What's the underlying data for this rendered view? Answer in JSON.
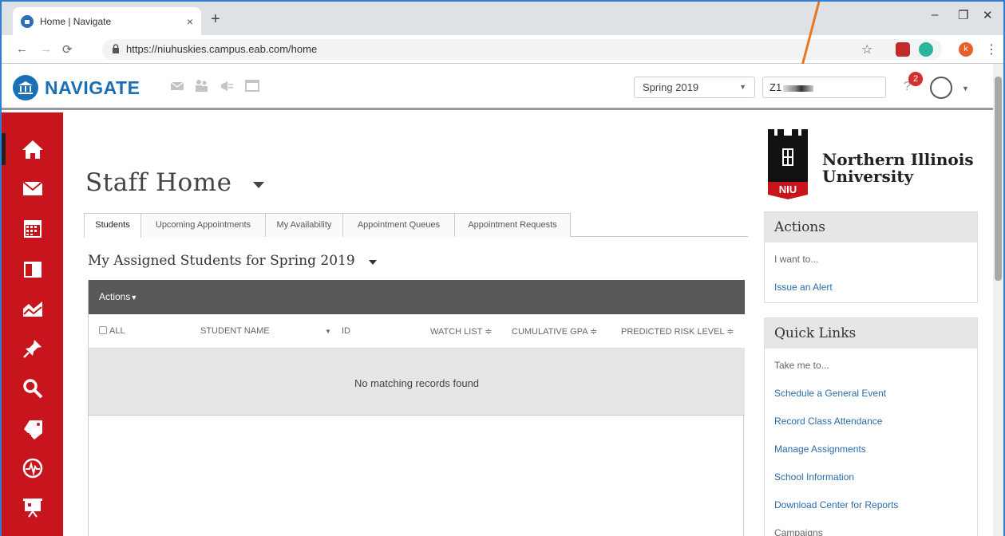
{
  "browser": {
    "tab_title": "Home | Navigate",
    "tab_close": "×",
    "new_tab": "+",
    "url": "https://niuhuskies.campus.eab.com/home",
    "profile_initial": "k",
    "window_controls": {
      "minimize": "–",
      "restore": "❐",
      "close": "✕"
    }
  },
  "header": {
    "brand": "NAVIGATE",
    "term": "Spring 2019",
    "search_value": "Z1",
    "notification_count": "2",
    "help": "?"
  },
  "sidebar": {
    "items": [
      "home-icon",
      "mail-icon",
      "calendar-icon",
      "book-icon",
      "reports-icon",
      "pin-icon",
      "search-icon",
      "add-tag-icon",
      "pulse-icon",
      "presentation-icon"
    ]
  },
  "main": {
    "title": "Staff Home",
    "tabs": [
      "Students",
      "Upcoming Appointments",
      "My Availability",
      "Appointment Queues",
      "Appointment Requests"
    ],
    "subheading": "My Assigned Students for Spring 2019",
    "table": {
      "actions_label": "Actions",
      "columns": {
        "all": "ALL",
        "student_name": "STUDENT NAME",
        "id": "ID",
        "watch_list": "WATCH LIST ≑",
        "gpa": "CUMULATIVE GPA ≑",
        "risk": "PREDICTED RISK LEVEL ≑"
      },
      "empty_message": "No matching records found"
    }
  },
  "right": {
    "university_line1": "Northern Illinois",
    "university_line2": "University",
    "seal_text": "NIU",
    "actions_panel": {
      "title": "Actions",
      "prompt": "I want to...",
      "links": [
        "Issue an Alert"
      ]
    },
    "quick_links_panel": {
      "title": "Quick Links",
      "prompt": "Take me to...",
      "links": [
        "Schedule a General Event",
        "Record Class Attendance",
        "Manage Assignments",
        "School Information",
        "Download Center for Reports",
        "Campaigns"
      ]
    }
  },
  "colors": {
    "brand_blue": "#1a6fb5",
    "sidebar_red": "#c8141c",
    "link_blue": "#2a6ca8",
    "annotation_orange": "#e87722"
  }
}
